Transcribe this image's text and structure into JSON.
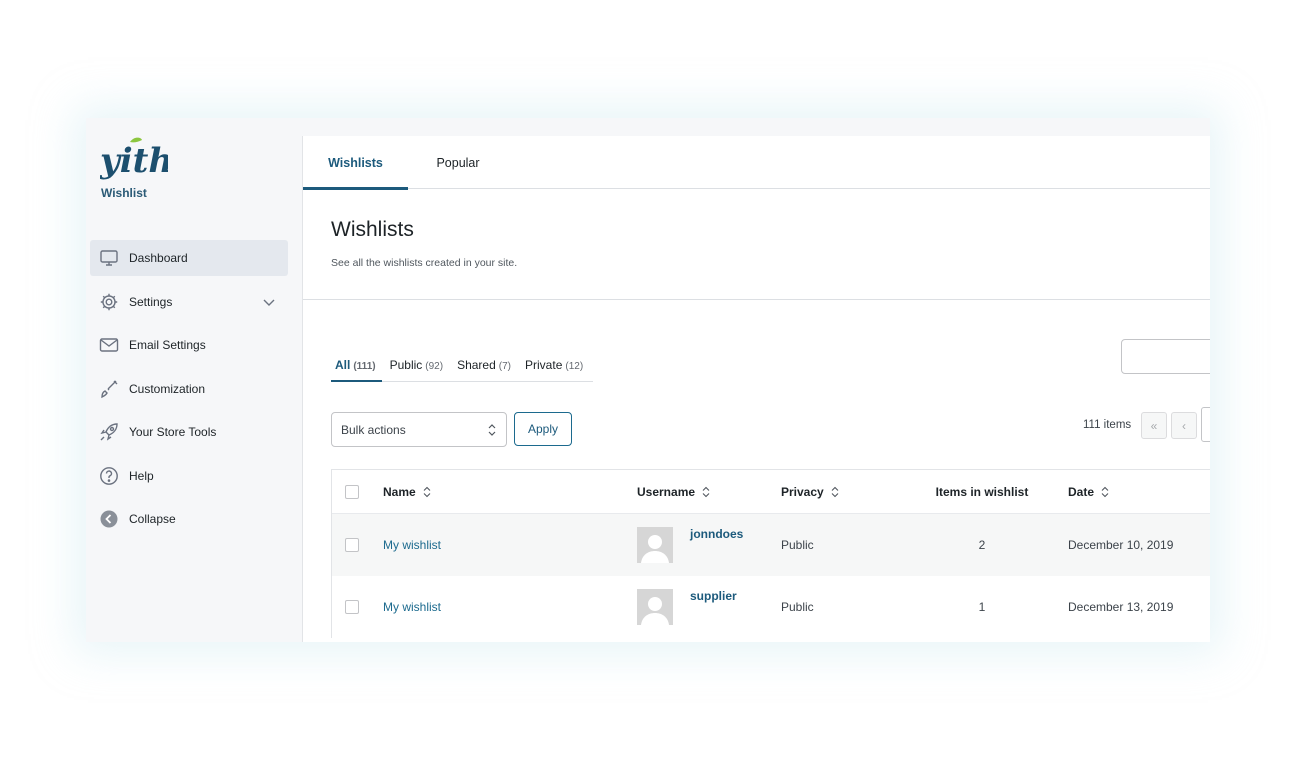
{
  "brand": {
    "logo_text": "yith",
    "subtitle": "Wishlist",
    "colors": {
      "logo": "#1c4f6e",
      "leaf": "#8cc63f",
      "accent": "#1c5a7c"
    }
  },
  "sidebar": {
    "items": [
      {
        "label": "Dashboard",
        "icon": "monitor-icon",
        "active": true
      },
      {
        "label": "Settings",
        "icon": "gear-icon",
        "has_submenu": true
      },
      {
        "label": "Email Settings",
        "icon": "envelope-icon"
      },
      {
        "label": "Customization",
        "icon": "brush-icon"
      },
      {
        "label": "Your Store Tools",
        "icon": "rocket-icon"
      },
      {
        "label": "Help",
        "icon": "question-icon"
      },
      {
        "label": "Collapse",
        "icon": "collapse-arrow-icon"
      }
    ]
  },
  "tabs": [
    {
      "label": "Wishlists",
      "active": true
    },
    {
      "label": "Popular"
    }
  ],
  "page": {
    "title": "Wishlists",
    "description": "See all the wishlists created in your site."
  },
  "filters": [
    {
      "label": "All",
      "count": "(111)",
      "active": true
    },
    {
      "label": "Public",
      "count": "(92)"
    },
    {
      "label": "Shared",
      "count": "(7)"
    },
    {
      "label": "Private",
      "count": "(12)"
    }
  ],
  "toolbar": {
    "bulk_actions": "Bulk actions",
    "apply_label": "Apply",
    "items_count": "111 items",
    "first_page": "«",
    "prev_page": "‹"
  },
  "table": {
    "columns": [
      "Name",
      "Username",
      "Privacy",
      "Items in wishlist",
      "Date"
    ],
    "rows": [
      {
        "name": "My wishlist",
        "username": "jonndoes",
        "privacy": "Public",
        "items": "2",
        "date": "December 10, 2019"
      },
      {
        "name": "My wishlist",
        "username": "supplier",
        "privacy": "Public",
        "items": "1",
        "date": "December 13, 2019"
      }
    ]
  }
}
